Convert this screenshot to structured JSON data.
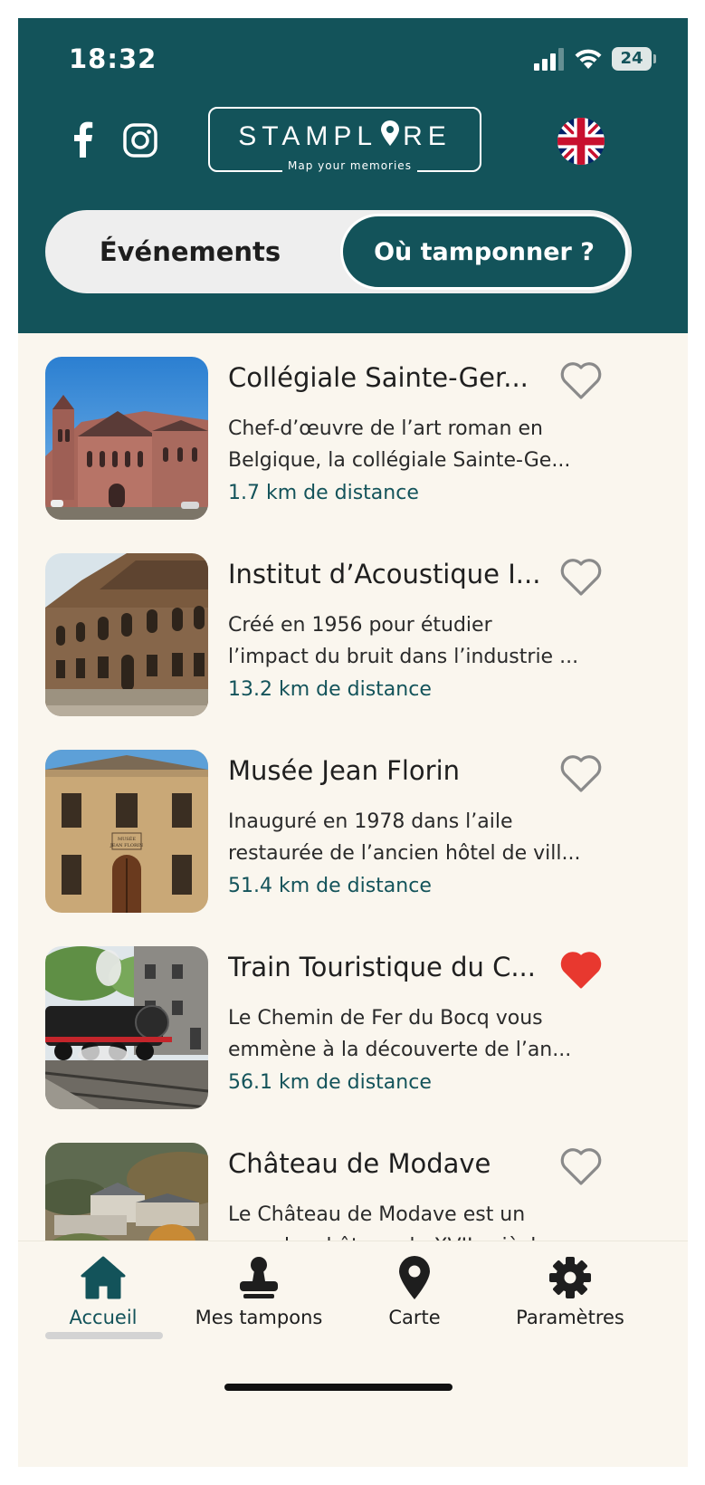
{
  "status_bar": {
    "time": "18:32",
    "battery": "24"
  },
  "header": {
    "logo": {
      "word_left": "STAMPL",
      "word_right": "RE",
      "tagline": "Map your memories"
    },
    "segment": {
      "left_label": "Événements",
      "right_label": "Où tamponner ?",
      "selected": "Où tamponner ?"
    }
  },
  "items": [
    {
      "title": "Collégiale Sainte-Ger...",
      "desc_line1": "Chef-d’œuvre de l’art roman en",
      "desc_line2": "Belgique, la collégiale Sainte-Ge...",
      "distance": "1.7 km de distance",
      "favorite": false,
      "image": "church"
    },
    {
      "title": "Institut d’Acoustique I...",
      "desc_line1": "Créé en 1956 pour étudier",
      "desc_line2": "l’impact du bruit dans l’industrie ...",
      "distance": "13.2 km de distance",
      "favorite": false,
      "image": "palace"
    },
    {
      "title": "Musée Jean Florin",
      "desc_line1": "Inauguré en 1978 dans l’aile",
      "desc_line2": "restaurée de l’ancien hôtel de vill...",
      "distance": "51.4 km de distance",
      "favorite": false,
      "image": "museum",
      "image_sign": "MUSÉE JEAN FLORIN"
    },
    {
      "title": "Train Touristique du C...",
      "desc_line1": "Le Chemin de Fer du Bocq vous",
      "desc_line2": "emmène à la découverte de l’an...",
      "distance": "56.1 km de distance",
      "favorite": true,
      "image": "train"
    },
    {
      "title": "Château de Modave",
      "desc_line1": "Le Château de Modave est un",
      "desc_line2": "superbe château du XVIIe siècle ...",
      "distance": "",
      "favorite": false,
      "image": "castle"
    }
  ],
  "nav": {
    "items": [
      {
        "label": "Accueil",
        "icon": "home-icon",
        "active": true
      },
      {
        "label": "Mes tampons",
        "icon": "stamp-icon",
        "active": false
      },
      {
        "label": "Carte",
        "icon": "map-pin-icon",
        "active": false
      },
      {
        "label": "Paramètres",
        "icon": "gear-icon",
        "active": false
      }
    ]
  },
  "colors": {
    "primary": "#13535a",
    "background": "#faf6ee",
    "heart_active": "#e8382f",
    "heart_inactive": "#8a8a8a"
  }
}
